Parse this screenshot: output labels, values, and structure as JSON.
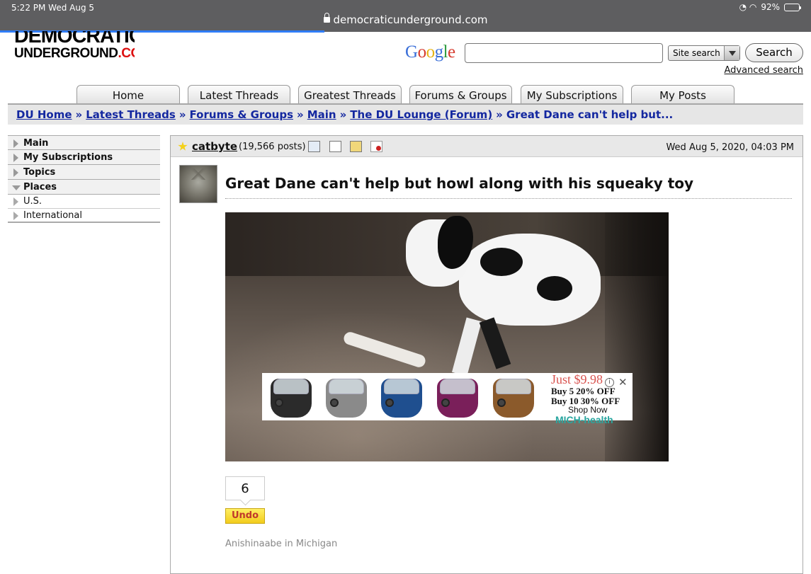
{
  "status": {
    "time": "5:22 PM   Wed Aug 5",
    "battery": "92%",
    "url": "democraticunderground.com"
  },
  "logo": {
    "line1": "DEMOCRATIC",
    "line2a": "UNDERGROUND",
    "line2b": ".COM"
  },
  "search": {
    "google": [
      "G",
      "o",
      "o",
      "g",
      "l",
      "e"
    ],
    "select_value": "Site search",
    "button": "Search",
    "advanced": "Advanced search"
  },
  "tabs": [
    "Home",
    "Latest Threads",
    "Greatest Threads",
    "Forums & Groups",
    "My Subscriptions",
    "My Posts"
  ],
  "breadcrumb": {
    "items": [
      "DU Home",
      "Latest Threads",
      "Forums & Groups",
      "Main",
      "The DU Lounge (Forum)"
    ],
    "current": "Great Dane can't help but...",
    "sep": "»"
  },
  "sidebar": {
    "items": [
      "Main",
      "My Subscriptions",
      "Topics",
      "Places"
    ],
    "subitems": [
      "U.S.",
      "International"
    ]
  },
  "post": {
    "author": "catbyte",
    "posts": "(19,566 posts)",
    "date": "Wed Aug 5, 2020, 04:03 PM",
    "title": "Great Dane can't help but howl along with his squeaky toy",
    "recommend_count": "6",
    "undo": "Undo",
    "signature": "Anishinaabe in Michigan"
  },
  "ad": {
    "price": "Just $9.98",
    "line1": "Buy 5 20% OFF",
    "line2": "Buy 10 30% OFF",
    "shop": "Shop Now",
    "brand": "MICH-health",
    "mask_colors": [
      "#2b2b2b",
      "#8a8a8a",
      "#1f4f8f",
      "#7a1f5a",
      "#8b5a2b"
    ]
  }
}
